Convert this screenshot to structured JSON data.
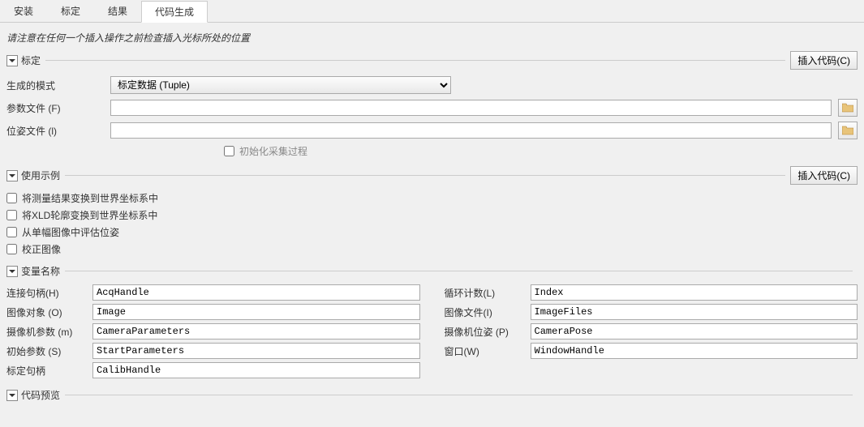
{
  "tabs": {
    "t0": "安装",
    "t1": "标定",
    "t2": "结果",
    "t3": "代码生成"
  },
  "hint": "请注意在任何一个插入操作之前检查插入光标所处的位置",
  "sections": {
    "calib": {
      "title": "标定",
      "insert": "插入代码(C)"
    },
    "usage": {
      "title": "使用示例",
      "insert": "插入代码(C)"
    },
    "vars": {
      "title": "变量名称"
    },
    "preview": {
      "title": "代码预览"
    }
  },
  "form": {
    "genModeLabel": "生成的模式",
    "genModeValue": "标定数据 (Tuple)",
    "paramFileLabel": "参数文件 (F)",
    "paramFileValue": "",
    "poseFileLabel": "位姿文件 (l)",
    "poseFileValue": "",
    "initProcLabel": "初始化采集过程"
  },
  "usageChecks": {
    "c0": "将测量结果变换到世界坐标系中",
    "c1": "将XLD轮廓变换到世界坐标系中",
    "c2": "从单幅图像中评估位姿",
    "c3": "校正图像"
  },
  "vars": {
    "l0": {
      "label": "连接句柄(H)",
      "value": "AcqHandle"
    },
    "l1": {
      "label": "图像对象 (O)",
      "value": "Image"
    },
    "l2": {
      "label": "摄像机参数 (m)",
      "value": "CameraParameters"
    },
    "l3": {
      "label": "初始参数 (S)",
      "value": "StartParameters"
    },
    "l4": {
      "label": "标定句柄",
      "value": "CalibHandle"
    },
    "r0": {
      "label": "循环计数(L)",
      "value": "Index"
    },
    "r1": {
      "label": "图像文件(I)",
      "value": "ImageFiles"
    },
    "r2": {
      "label": "摄像机位姿 (P)",
      "value": "CameraPose"
    },
    "r3": {
      "label": "窗口(W)",
      "value": "WindowHandle"
    }
  }
}
